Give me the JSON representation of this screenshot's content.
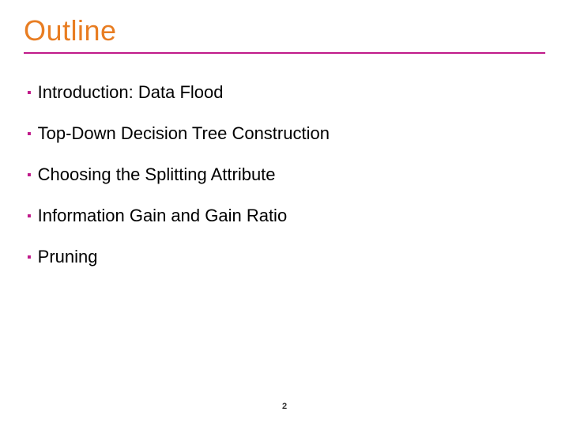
{
  "title": "Outline",
  "items": [
    "Introduction: Data Flood",
    "Top-Down Decision Tree Construction",
    "Choosing the Splitting Attribute",
    "Information Gain and Gain Ratio",
    "Pruning"
  ],
  "page_number": "2"
}
